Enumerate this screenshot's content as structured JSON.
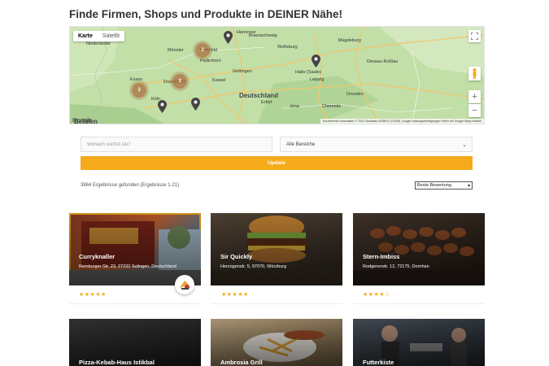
{
  "heading": "Finde Firmen, Shops und Produkte in DEINER Nähe!",
  "map": {
    "tabs": [
      "Karte",
      "Satellit"
    ],
    "active_tab": "Karte",
    "country_label": "Deutschland",
    "cities": [
      "Niederlande",
      "Münster",
      "Bielefeld",
      "Paderborn",
      "Hannover",
      "Braunschweig",
      "Magdeburg",
      "Halle (Saale)",
      "Leipzig",
      "Dresden",
      "Göttingen",
      "Kassel",
      "Erfurt",
      "Chemnitz",
      "Essen",
      "Düsseldorf",
      "Köln",
      "Belgien",
      "Wolfsburg",
      "Dessau-Roßlau",
      "Jena"
    ],
    "clusters": [
      "2",
      "3",
      "3"
    ],
    "zoom_in": "+",
    "zoom_out": "−",
    "footer": "Kurzbefehle   Kartendaten © 2022 GeoBasis-DE/BKG (©2009), Google   Nutzungsbedingungen   Fehler bei Google Maps melden",
    "google": "Google"
  },
  "search": {
    "placeholder": "Wonach suchst Du?",
    "area": "Alle Bereiche",
    "update": "Update"
  },
  "results": {
    "count_text": "3864 Ergebnisse gefunden (Ergebnisse 1-21)",
    "sort": "Beste Bewertung"
  },
  "listings": [
    {
      "name": "Curryknaller",
      "address": "Remburger Str. 23, 27232 Sulingen, Deutschland",
      "stars": "★★★★★",
      "rating": 5
    },
    {
      "name": "Sir Quickly",
      "address": "Herzogenstr. 5, 97070, Würzburg",
      "stars": "★★★★★",
      "rating": 5
    },
    {
      "name": "Stern-Imbiss",
      "address": "Rodgerenstr. 12, 72175, Dornhan",
      "stars": "★★★★☆",
      "rating": 4
    },
    {
      "name": "Pizza-Kebab-Haus Istikbal",
      "address": "",
      "stars": "",
      "rating": null
    },
    {
      "name": "Ambrosia Grill",
      "address": "",
      "stars": "",
      "rating": null
    },
    {
      "name": "Futterkiste",
      "address": "",
      "stars": "",
      "rating": null
    }
  ],
  "colors": {
    "accent": "#f4aa1a",
    "map_land": "#b8d9a0"
  }
}
